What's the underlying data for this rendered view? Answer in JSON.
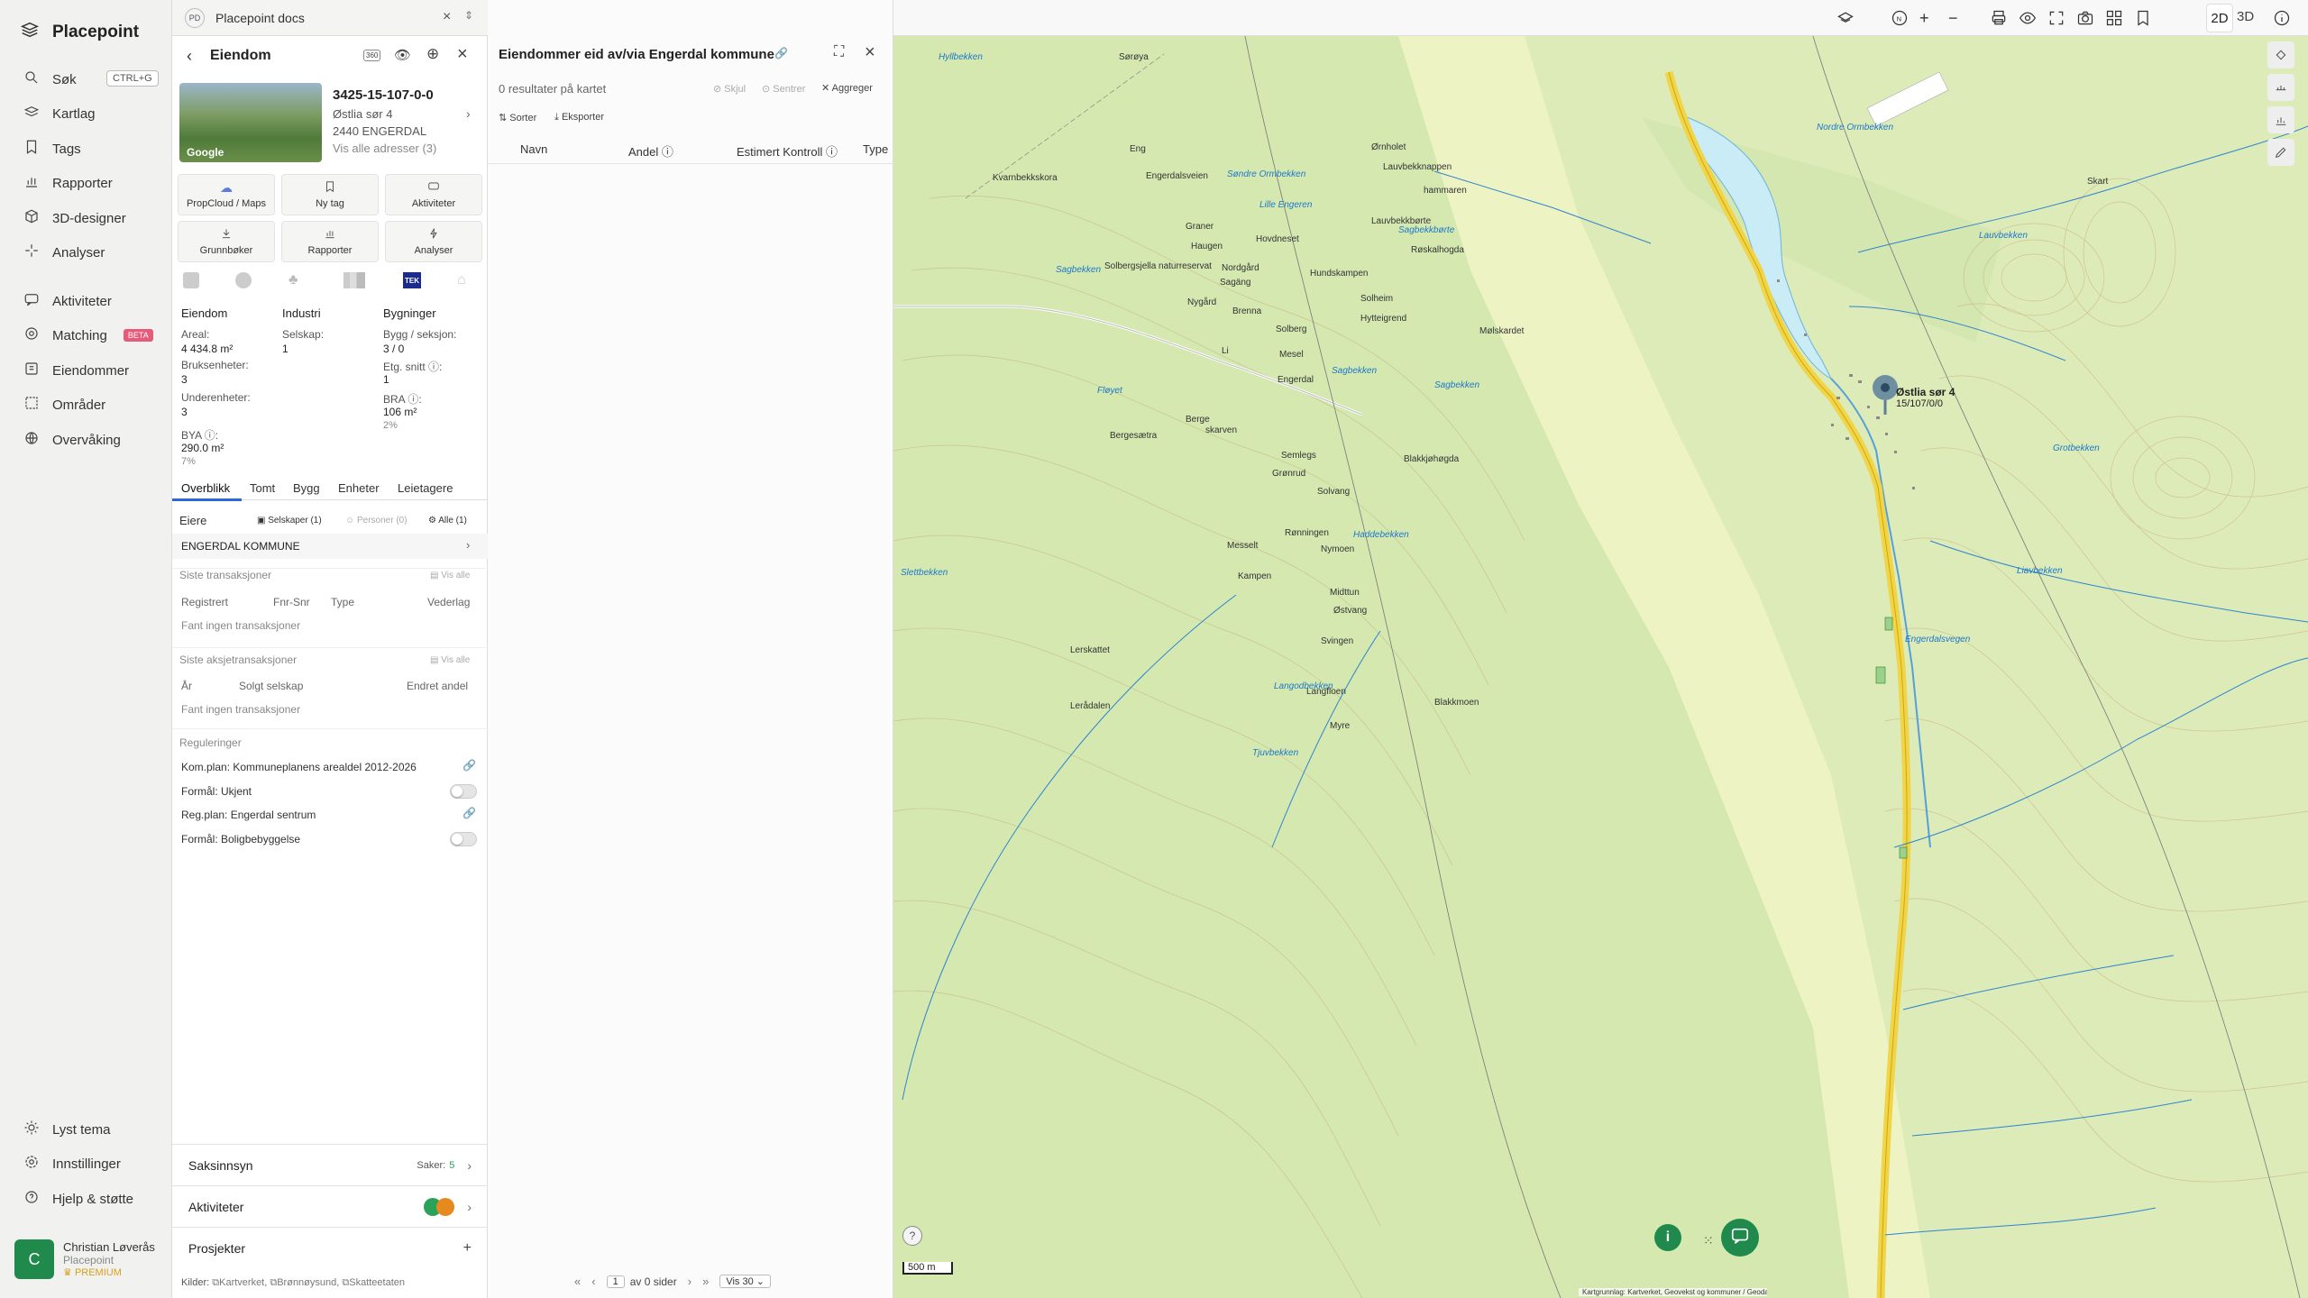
{
  "app": {
    "name": "Placepoint",
    "tab_title": "Placepoint docs",
    "tab_badge": "PD"
  },
  "nav": {
    "search": "Søk",
    "search_shortcut": "CTRL+G",
    "map_layer": "Kartlag",
    "tags": "Tags",
    "reports": "Rapporter",
    "designer": "3D-designer",
    "analyses": "Analyser",
    "activities": "Aktiviteter",
    "matching": "Matching",
    "matching_badge": "BETA",
    "properties": "Eiendommer",
    "areas": "Områder",
    "monitoring": "Overvåking",
    "theme": "Lyst tema",
    "settings": "Innstillinger",
    "help": "Hjelp & støtte"
  },
  "user": {
    "initial": "C",
    "name": "Christian Løverås",
    "org": "Placepoint",
    "plan": "PREMIUM"
  },
  "property": {
    "header": "Eiendom",
    "id": "3425-15-107-0-0",
    "address1": "Østlia sør 4",
    "address2": "2440 ENGERDAL",
    "all_addresses": "Vis alle adresser (3)",
    "thumb_brand": "Google",
    "tiles": [
      "PropCloud / Maps",
      "Ny tag",
      "Aktiviteter",
      "Grunnbøker",
      "Rapporter",
      "Analyser"
    ],
    "tek_badge": "TEK",
    "col1_title": "Eiendom",
    "col2_title": "Industri",
    "col3_title": "Bygninger",
    "area_label": "Areal:",
    "area_value": "4 434.8",
    "area_unit": "m²",
    "company_label": "Selskap:",
    "company_value": "1",
    "buildsec_label": "Bygg / seksjon:",
    "buildsec_value": "3 / 0",
    "units_label": "Bruksenheter:",
    "units_value": "3",
    "floors_label": "Etg. snitt ⓘ:",
    "floors_value": "1",
    "subunits_label": "Underenheter:",
    "subunits_value": "3",
    "bra_label": "BRA ⓘ:",
    "bra_value": "106",
    "bra_unit": "m²",
    "bra_pct": "2%",
    "bya_label": "BYA ⓘ:",
    "bya_value": "290.0",
    "bya_unit": "m²",
    "bya_pct": "7%",
    "tabs": [
      "Overblikk",
      "Tomt",
      "Bygg",
      "Enheter",
      "Leietagere"
    ],
    "owners_label": "Eiere",
    "owner_filters": [
      "Selskaper (1)",
      "Personer (0)",
      "Alle (1)"
    ],
    "owner": "ENGERDAL KOMMUNE",
    "tx_title": "Siste transaksjoner",
    "show_all": "Vis alle",
    "tx_cols": [
      "Registrert",
      "Fnr-Snr",
      "Type",
      "Vederlag"
    ],
    "tx_empty": "Fant ingen transaksjoner",
    "stx_title": "Siste aksjetransaksjoner",
    "stx_cols": [
      "År",
      "Solgt selskap",
      "Endret andel"
    ],
    "stx_empty": "Fant ingen transaksjoner",
    "reg_title": "Reguleringer",
    "regs": [
      "Kom.plan: Kommuneplanens arealdel 2012-2026",
      "Formål: Ukjent",
      "Reg.plan: Engerdal sentrum",
      "Formål: Boligbebyggelse"
    ],
    "case_label": "Saksinnsyn",
    "case_count_label": "Saker:",
    "case_count": "5",
    "activities_label": "Aktiviteter",
    "projects_label": "Prosjekter",
    "sources_label": "Kilder:",
    "sources": [
      "Kartverket,",
      "Brønnøysund,",
      "Skatteetaten"
    ]
  },
  "results": {
    "title": "Eiendommer eid av/via Engerdal kommune",
    "count": "0 resultater på kartet",
    "hide": "Skjul",
    "center": "Sentrer",
    "aggregate": "Aggreger",
    "sort": "Sorter",
    "export": "Eksporter",
    "columns": [
      "Navn",
      "Andel ⓘ",
      "Estimert Kontroll ⓘ",
      "Type"
    ],
    "page": "1",
    "of_pages": "av 0 sider",
    "per_page": "Vis 30"
  },
  "map": {
    "mode2d": "2D",
    "mode3d": "3D",
    "scale": "500 m",
    "pin_label": "Østlia sør 4",
    "pin_id": "15/107/0/0",
    "attribution": "Kartgrunnlag: Kartverket, Geovekst og kommuner / Geodata AS. Powered by Esri",
    "places": [
      "Sørøya",
      "Eng",
      "Kvarnbekkskora",
      "Graner",
      "Haugen",
      "Nordgård",
      "Sagäng",
      "Nygård",
      "Brenna",
      "Solheim",
      "Lauvbekknappen",
      "Lauvbekkbørte",
      "Hovdneset",
      "Ørnholet",
      "Solberg",
      "Hytteigrend",
      "Hundskampen",
      "Røskalhogda",
      "hammaren",
      "Skart",
      "Li",
      "Mesel",
      "Engerdal",
      "Berge",
      "Bergesætra",
      "skarven",
      "Semlegs",
      "Grønrud",
      "Solvang",
      "Rønningen",
      "Nymoen",
      "Messelt",
      "Kampen",
      "Midttun",
      "Østvang",
      "Svingen",
      "Langfloen",
      "Myre",
      "Blakkjøhøgda",
      "Mølskardet",
      "Blakkmoen",
      "Engerdalsveien",
      "Solbergsjella naturreservat",
      "Lerskattet",
      "Lerådalen"
    ],
    "waters": [
      "Hyllbekken",
      "Sagbekken",
      "Lille Engeren",
      "Søndre Ormbekken",
      "Nordre Ormbekken",
      "Sagbekkbørte",
      "Sagbekken",
      "Fløyet",
      "Sagbekken",
      "Slettbekken",
      "Grotbekken",
      "Lauvbekken",
      "Liavbekken",
      "Langodbekken",
      "Tjuvbekken",
      "Haddebekken",
      "Engerdalsvegen"
    ]
  }
}
